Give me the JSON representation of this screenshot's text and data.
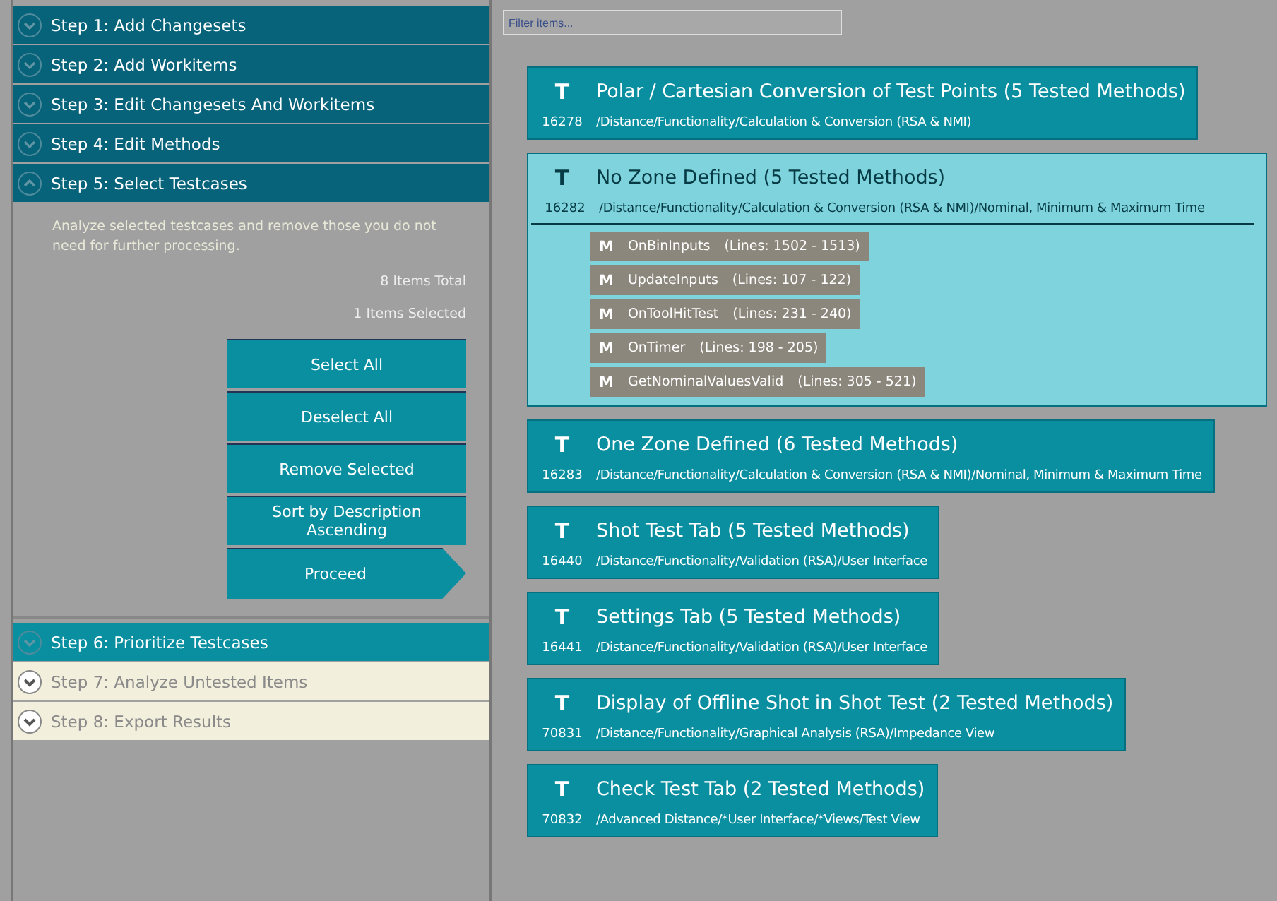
{
  "steps": [
    {
      "label": "Step 1: Add Changesets",
      "kind": "done",
      "expanded": false
    },
    {
      "label": "Step 2: Add Workitems",
      "kind": "done",
      "expanded": false
    },
    {
      "label": "Step 3: Edit Changesets And Workitems",
      "kind": "done",
      "expanded": false
    },
    {
      "label": "Step 4: Edit Methods",
      "kind": "done",
      "expanded": false
    },
    {
      "label": "Step 5: Select Testcases",
      "kind": "done",
      "expanded": true,
      "panel": {
        "description": "Analyze selected testcases and remove those you do not need for further processing.",
        "total": "8 Items Total",
        "selected_count": "1 Items Selected",
        "buttons": [
          {
            "label": "Select All",
            "kind": "plain"
          },
          {
            "label": "Deselect All",
            "kind": "plain"
          },
          {
            "label": "Remove Selected",
            "kind": "plain"
          },
          {
            "label": "Sort by Description Ascending",
            "kind": "plain"
          },
          {
            "label": "Proceed",
            "kind": "arrow"
          }
        ]
      }
    },
    {
      "label": "Step 6: Prioritize Testcases",
      "kind": "current",
      "expanded": false
    },
    {
      "label": "Step 7: Analyze Untested Items",
      "kind": "locked",
      "expanded": false
    },
    {
      "label": "Step 8: Export Results",
      "kind": "locked",
      "expanded": false
    }
  ],
  "filter": {
    "placeholder": "Filter items..."
  },
  "testcases": [
    {
      "badge": "T",
      "title": "Polar / Cartesian Conversion of Test Points (5 Tested Methods)",
      "id": "16278",
      "path": "/Distance/Functionality/Calculation & Conversion (RSA & NMI)",
      "selected": false
    },
    {
      "badge": "T",
      "title": "No Zone Defined (5 Tested Methods)",
      "id": "16282",
      "path": "/Distance/Functionality/Calculation & Conversion (RSA & NMI)/Nominal, Minimum & Maximum Time",
      "selected": true,
      "methods": [
        {
          "badge": "M",
          "name": "OnBinInputs",
          "lines": "(Lines: 1502 - 1513)"
        },
        {
          "badge": "M",
          "name": "UpdateInputs",
          "lines": "(Lines: 107 - 122)"
        },
        {
          "badge": "M",
          "name": "OnToolHitTest",
          "lines": "(Lines: 231 - 240)"
        },
        {
          "badge": "M",
          "name": "OnTimer",
          "lines": "(Lines: 198 - 205)"
        },
        {
          "badge": "M",
          "name": "GetNominalValuesValid",
          "lines": "(Lines: 305 - 521)"
        }
      ]
    },
    {
      "badge": "T",
      "title": "One Zone Defined (6 Tested Methods)",
      "id": "16283",
      "path": "/Distance/Functionality/Calculation & Conversion (RSA & NMI)/Nominal, Minimum & Maximum Time",
      "selected": false
    },
    {
      "badge": "T",
      "title": "Shot Test Tab (5 Tested Methods)",
      "id": "16440",
      "path": "/Distance/Functionality/Validation (RSA)/User Interface",
      "selected": false
    },
    {
      "badge": "T",
      "title": "Settings Tab (5 Tested Methods)",
      "id": "16441",
      "path": "/Distance/Functionality/Validation (RSA)/User Interface",
      "selected": false
    },
    {
      "badge": "T",
      "title": "Display of Offline Shot in Shot Test (2 Tested Methods)",
      "id": "70831",
      "path": "/Distance/Functionality/Graphical Analysis (RSA)/Impedance View",
      "selected": false
    },
    {
      "badge": "T",
      "title": "Check Test Tab (2 Tested Methods)",
      "id": "70832",
      "path": "/Advanced Distance/*User Interface/*Views/Test View",
      "selected": false
    }
  ]
}
